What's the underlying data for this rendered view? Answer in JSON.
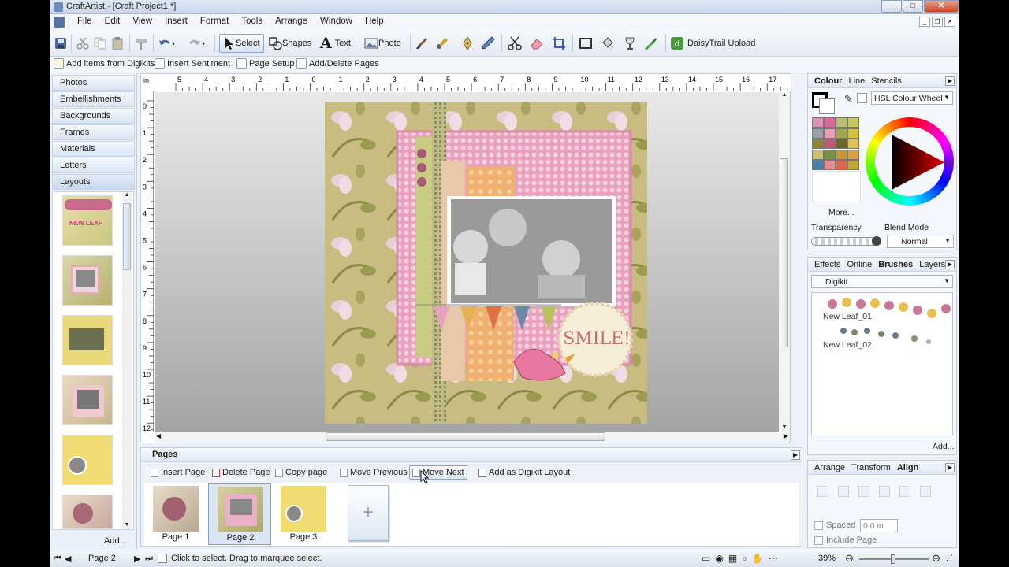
{
  "window": {
    "title": "CraftArtist - [Craft Project1 *]"
  },
  "menu": [
    "File",
    "Edit",
    "View",
    "Insert",
    "Format",
    "Tools",
    "Arrange",
    "Window",
    "Help"
  ],
  "toolbar": {
    "select": "Select",
    "shapes": "Shapes",
    "text": "Text",
    "photo": "Photo",
    "daisytrail": "DaisyTrail Upload"
  },
  "toolbar2": {
    "add_items": "Add items from Digikits",
    "insert_sentiment": "Insert Sentiment",
    "page_setup": "Page Setup",
    "add_delete_pages": "Add/Delete Pages"
  },
  "left_panel": {
    "categories": [
      "Photos",
      "Embellishments",
      "Backgrounds",
      "Frames",
      "Materials",
      "Letters",
      "Layouts"
    ],
    "active": "Layouts",
    "thumb_label": "NEW LEAF",
    "add_label": "Add..."
  },
  "rulers": {
    "unit": "in",
    "h_labels": [
      "5",
      "4",
      "3",
      "2",
      "1",
      "0",
      "1",
      "2",
      "3",
      "4",
      "5",
      "6",
      "7",
      "8",
      "9",
      "10",
      "11",
      "12",
      "13",
      "14",
      "15",
      "16",
      "17"
    ],
    "v_labels": [
      "0",
      "1",
      "2",
      "3",
      "4",
      "5",
      "6",
      "7",
      "8",
      "9",
      "10",
      "11",
      "12"
    ]
  },
  "canvas": {
    "embellishment_text": "SMILE!"
  },
  "colour_panel": {
    "tabs": [
      "Colour",
      "Line",
      "Stencils"
    ],
    "active_tab": "Colour",
    "wheel_mode": "HSL Colour Wheel",
    "more_label": "More...",
    "transparency_label": "Transparency",
    "blend_mode_label": "Blend Mode",
    "blend_mode_value": "Normal",
    "swatches": [
      "#e090b0",
      "#d86a9a",
      "#b8c070",
      "#c8c860",
      "#9aa0a8",
      "#e8a0b8",
      "#a0a848",
      "#d8c040",
      "#908830",
      "#c05878",
      "#706820",
      "#e0c050",
      "#c8c070",
      "#789048",
      "#c89830",
      "#d8a040",
      "#4880a8",
      "#e09090",
      "#e06848",
      "#c0a838"
    ]
  },
  "brushes_panel": {
    "tabs": [
      "Effects",
      "Online",
      "Brushes",
      "Layers"
    ],
    "active_tab": "Brushes",
    "category": "Digikit",
    "brushes": [
      "New Leaf_01",
      "New Leaf_02"
    ],
    "add_label": "Add..."
  },
  "align_panel": {
    "tabs": [
      "Arrange",
      "Transform",
      "Align"
    ],
    "active_tab": "Align",
    "spaced_label": "Spaced",
    "spaced_value": "0.0 in",
    "include_page_label": "Include Page"
  },
  "pages_panel": {
    "title": "Pages",
    "actions": [
      "Insert Page",
      "Delete Page",
      "Copy page",
      "Move Previous",
      "Move Next",
      "Add as Digikit Layout"
    ],
    "pages": [
      "Page 1",
      "Page 2",
      "Page 3"
    ],
    "selected_page": "Page 2"
  },
  "statusbar": {
    "page": "Page 2",
    "message": "Click to select. Drag to marquee select.",
    "zoom": "39%"
  }
}
